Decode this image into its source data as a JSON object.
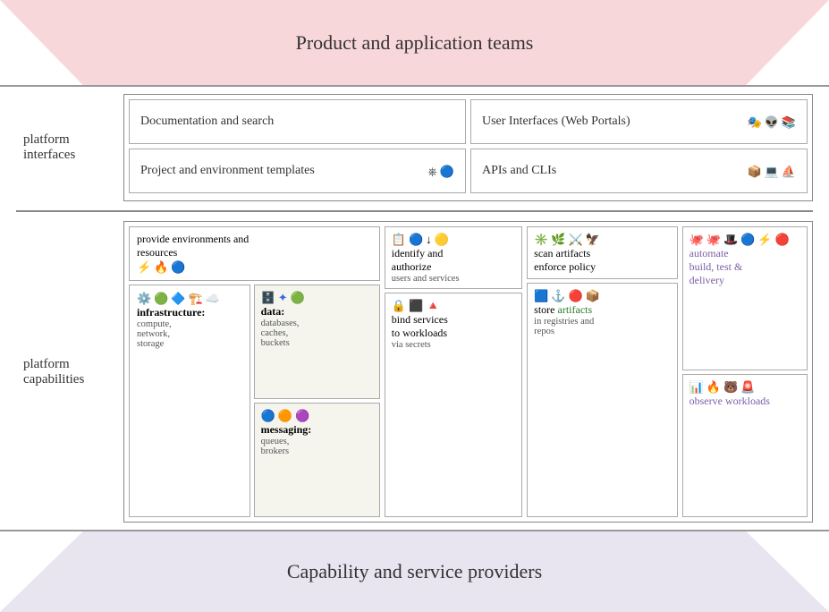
{
  "top_banner": {
    "text": "Product and application teams"
  },
  "bottom_banner": {
    "text": "Capability and service providers"
  },
  "platform_interfaces": {
    "label": "platform\ninterfaces",
    "cells": {
      "doc_search": "Documentation and search",
      "user_interfaces": "User Interfaces (Web Portals)",
      "project_templates": "Project and environment templates",
      "apis_clis": "APIs and CLIs"
    }
  },
  "platform_capabilities": {
    "label": "platform\ncapabilities",
    "provide_env": {
      "title": "provide environments and",
      "title2": "resources",
      "infrastructure_label": "infrastructure:",
      "infrastructure_items": "compute,\nnetwork,\nstorage",
      "data_label": "data:",
      "data_items": "databases,\ncaches,\nbuckets",
      "messaging_label": "messaging:",
      "messaging_items": "queues,\nbrokers"
    },
    "identity": {
      "title": "identify and\nauthorize",
      "subtitle": "users and services",
      "bind_title": "bind services\nto workloads",
      "bind_subtitle": "via secrets"
    },
    "artifacts": {
      "scan_title": "scan artifacts\nenforce policy",
      "store_title": "store",
      "store_highlight": "artifacts",
      "store_subtitle": "in registries and\nrepos"
    },
    "automate": {
      "title": "automate\nbuild, test &\ndelivery",
      "observe_title": "observe\nworkloads"
    }
  }
}
